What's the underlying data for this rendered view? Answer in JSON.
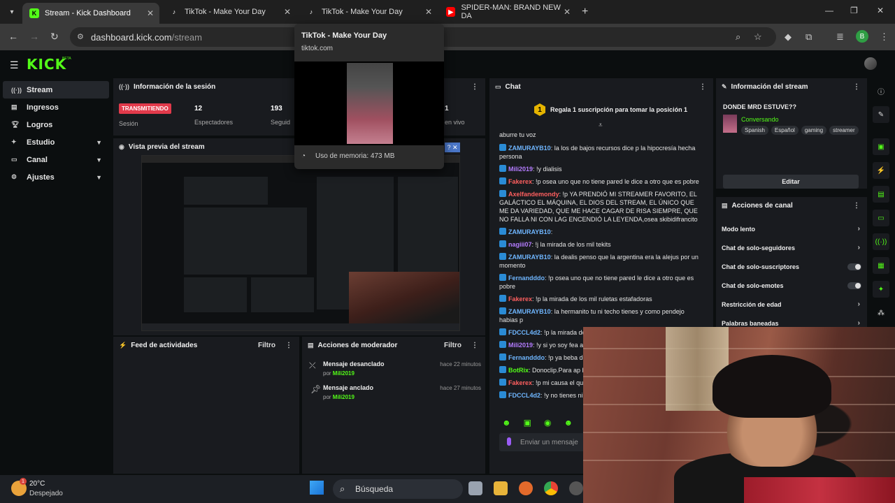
{
  "browser": {
    "tabs": [
      {
        "label": "Stream - Kick Dashboard",
        "active": true
      },
      {
        "label": "TikTok - Make Your Day"
      },
      {
        "label": "TikTok - Make Your Day"
      },
      {
        "label": "SPIDER-MAN: BRAND NEW DA"
      }
    ],
    "address": {
      "domain": "dashboard.kick.com",
      "path": "/stream"
    },
    "profile_initial": "B"
  },
  "hovercard": {
    "title": "TikTok - Make Your Day",
    "url": "tiktok.com",
    "memory": "Uso de memoria: 473 MB"
  },
  "kick": {
    "logo": "KICK",
    "beta": "BETA",
    "sidebar": [
      {
        "label": "Stream",
        "icon": "signal-icon",
        "active": true
      },
      {
        "label": "Ingresos",
        "icon": "money-icon"
      },
      {
        "label": "Logros",
        "icon": "trophy-icon"
      },
      {
        "label": "Estudio",
        "icon": "studio-icon",
        "chevron": true
      },
      {
        "label": "Canal",
        "icon": "channel-icon",
        "chevron": true
      },
      {
        "label": "Ajustes",
        "icon": "gear-icon",
        "chevron": true
      }
    ],
    "session": {
      "title": "Información de la sesión",
      "live": "TRANSMITIENDO",
      "session_label": "Sesión",
      "viewers": "12",
      "viewers_label": "Espectadores",
      "followers": "193",
      "followers_label": "Seguid",
      "live_num": "1",
      "live_label": "en vivo"
    },
    "preview": {
      "title": "Vista previa del stream"
    },
    "activity": {
      "title": "Feed de actividades",
      "filter": "Filtro"
    },
    "moderator": {
      "title": "Acciones de moderador",
      "filter": "Filtro",
      "items": [
        {
          "action": "Mensaje desanclado",
          "by_prefix": "por",
          "by": "Mili2019",
          "time": "hace 22 minutos"
        },
        {
          "action": "Mensaje anclado",
          "by_prefix": "por",
          "by": "Mili2019",
          "time": "hace 27 minutos"
        }
      ]
    },
    "chat": {
      "title": "Chat",
      "banner_rank": "1",
      "banner": "Regala 1 suscripción para tomar la posición 1",
      "first_line": "aburre tu voz",
      "messages": [
        {
          "user": "ZAMURAYB10",
          "color": "#6fb6ff",
          "text": "la los de bajos recursos dice p la hipocresía hecha persona"
        },
        {
          "user": "Mili2019",
          "color": "#b47cff",
          "text": "!y dialisis"
        },
        {
          "user": "Fakerex",
          "color": "#ff5f5f",
          "text": "!p osea uno que no tiene pared le dice a otro que es pobre"
        },
        {
          "user": "Axelfandemondy",
          "color": "#ff5f5f",
          "text": "!p YA PRENDIÓ MI STREAMER FAVORITO, EL GALÁCTICO EL MÁQUINA, EL DIOS DEL STREAM, EL ÚNICO QUE ME DA VARIEDAD, QUE ME HACE CAGAR DE RISA SIEMPRE, QUE NO FALLA NI CON LAG ENCENDIÓ LA LEYENDA,osea skibidifrancito"
        },
        {
          "user": "ZAMURAYB10",
          "color": "#6fb6ff",
          "text": ""
        },
        {
          "user": "nagiii07",
          "color": "#b47cff",
          "text": "!j la mirada de los mil tekits"
        },
        {
          "user": "ZAMURAYB10",
          "color": "#6fb6ff",
          "text": "la dealis penso que la argentina era la alejus por un momento"
        },
        {
          "user": "Fernandddo",
          "color": "#6fb6ff",
          "text": "!p osea uno que no tiene pared le dice a otro que es pobre"
        },
        {
          "user": "Fakerex",
          "color": "#ff5f5f",
          "text": "!p la mirada de los mil ruletas estafadoras"
        },
        {
          "user": "ZAMURAYB10",
          "color": "#6fb6ff",
          "text": "la hermanito tu ni techo tienes y como pendejo habias p"
        },
        {
          "user": "FDCCL4d2",
          "color": "#6fb6ff",
          "text": "!p la mirada de las mil kchadas"
        },
        {
          "user": "Mili2019",
          "color": "#b47cff",
          "text": "!y si yo soy fea an"
        },
        {
          "user": "Fernandddo",
          "color": "#6fb6ff",
          "text": "!p ya beba des chaufa"
        },
        {
          "user": "BotRix",
          "color": "#53fc18",
          "text": "Donoclip.Para ap https://www.donoclip.com/BRA"
        },
        {
          "user": "Fakerex",
          "color": "#ff5f5f",
          "text": "!p mi causa el que"
        },
        {
          "user": "FDCCL4d2",
          "color": "#6fb6ff",
          "text": "!y no tienes ni p"
        }
      ],
      "input_placeholder": "Enviar un mensaje"
    },
    "stream_info": {
      "title": "Información del stream",
      "stream_title": "DONDE MRD ESTUVE??",
      "category": "Conversando",
      "tags": [
        "Spanish",
        "Español",
        "gaming",
        "streamer"
      ],
      "edit": "Editar"
    },
    "channel_actions": {
      "title": "Acciones de canal",
      "items": [
        {
          "label": "Modo lento",
          "control": "chevron"
        },
        {
          "label": "Chat de solo-seguidores",
          "control": "chevron"
        },
        {
          "label": "Chat de solo-suscriptores",
          "control": "toggle"
        },
        {
          "label": "Chat de solo-emotes",
          "control": "toggle"
        },
        {
          "label": "Restricción de edad",
          "control": "chevron"
        },
        {
          "label": "Palabras baneadas",
          "control": "chevron"
        }
      ]
    }
  },
  "taskbar": {
    "temp": "20°C",
    "weather": "Despejado",
    "weather_badge": "1",
    "search": "Búsqueda"
  }
}
